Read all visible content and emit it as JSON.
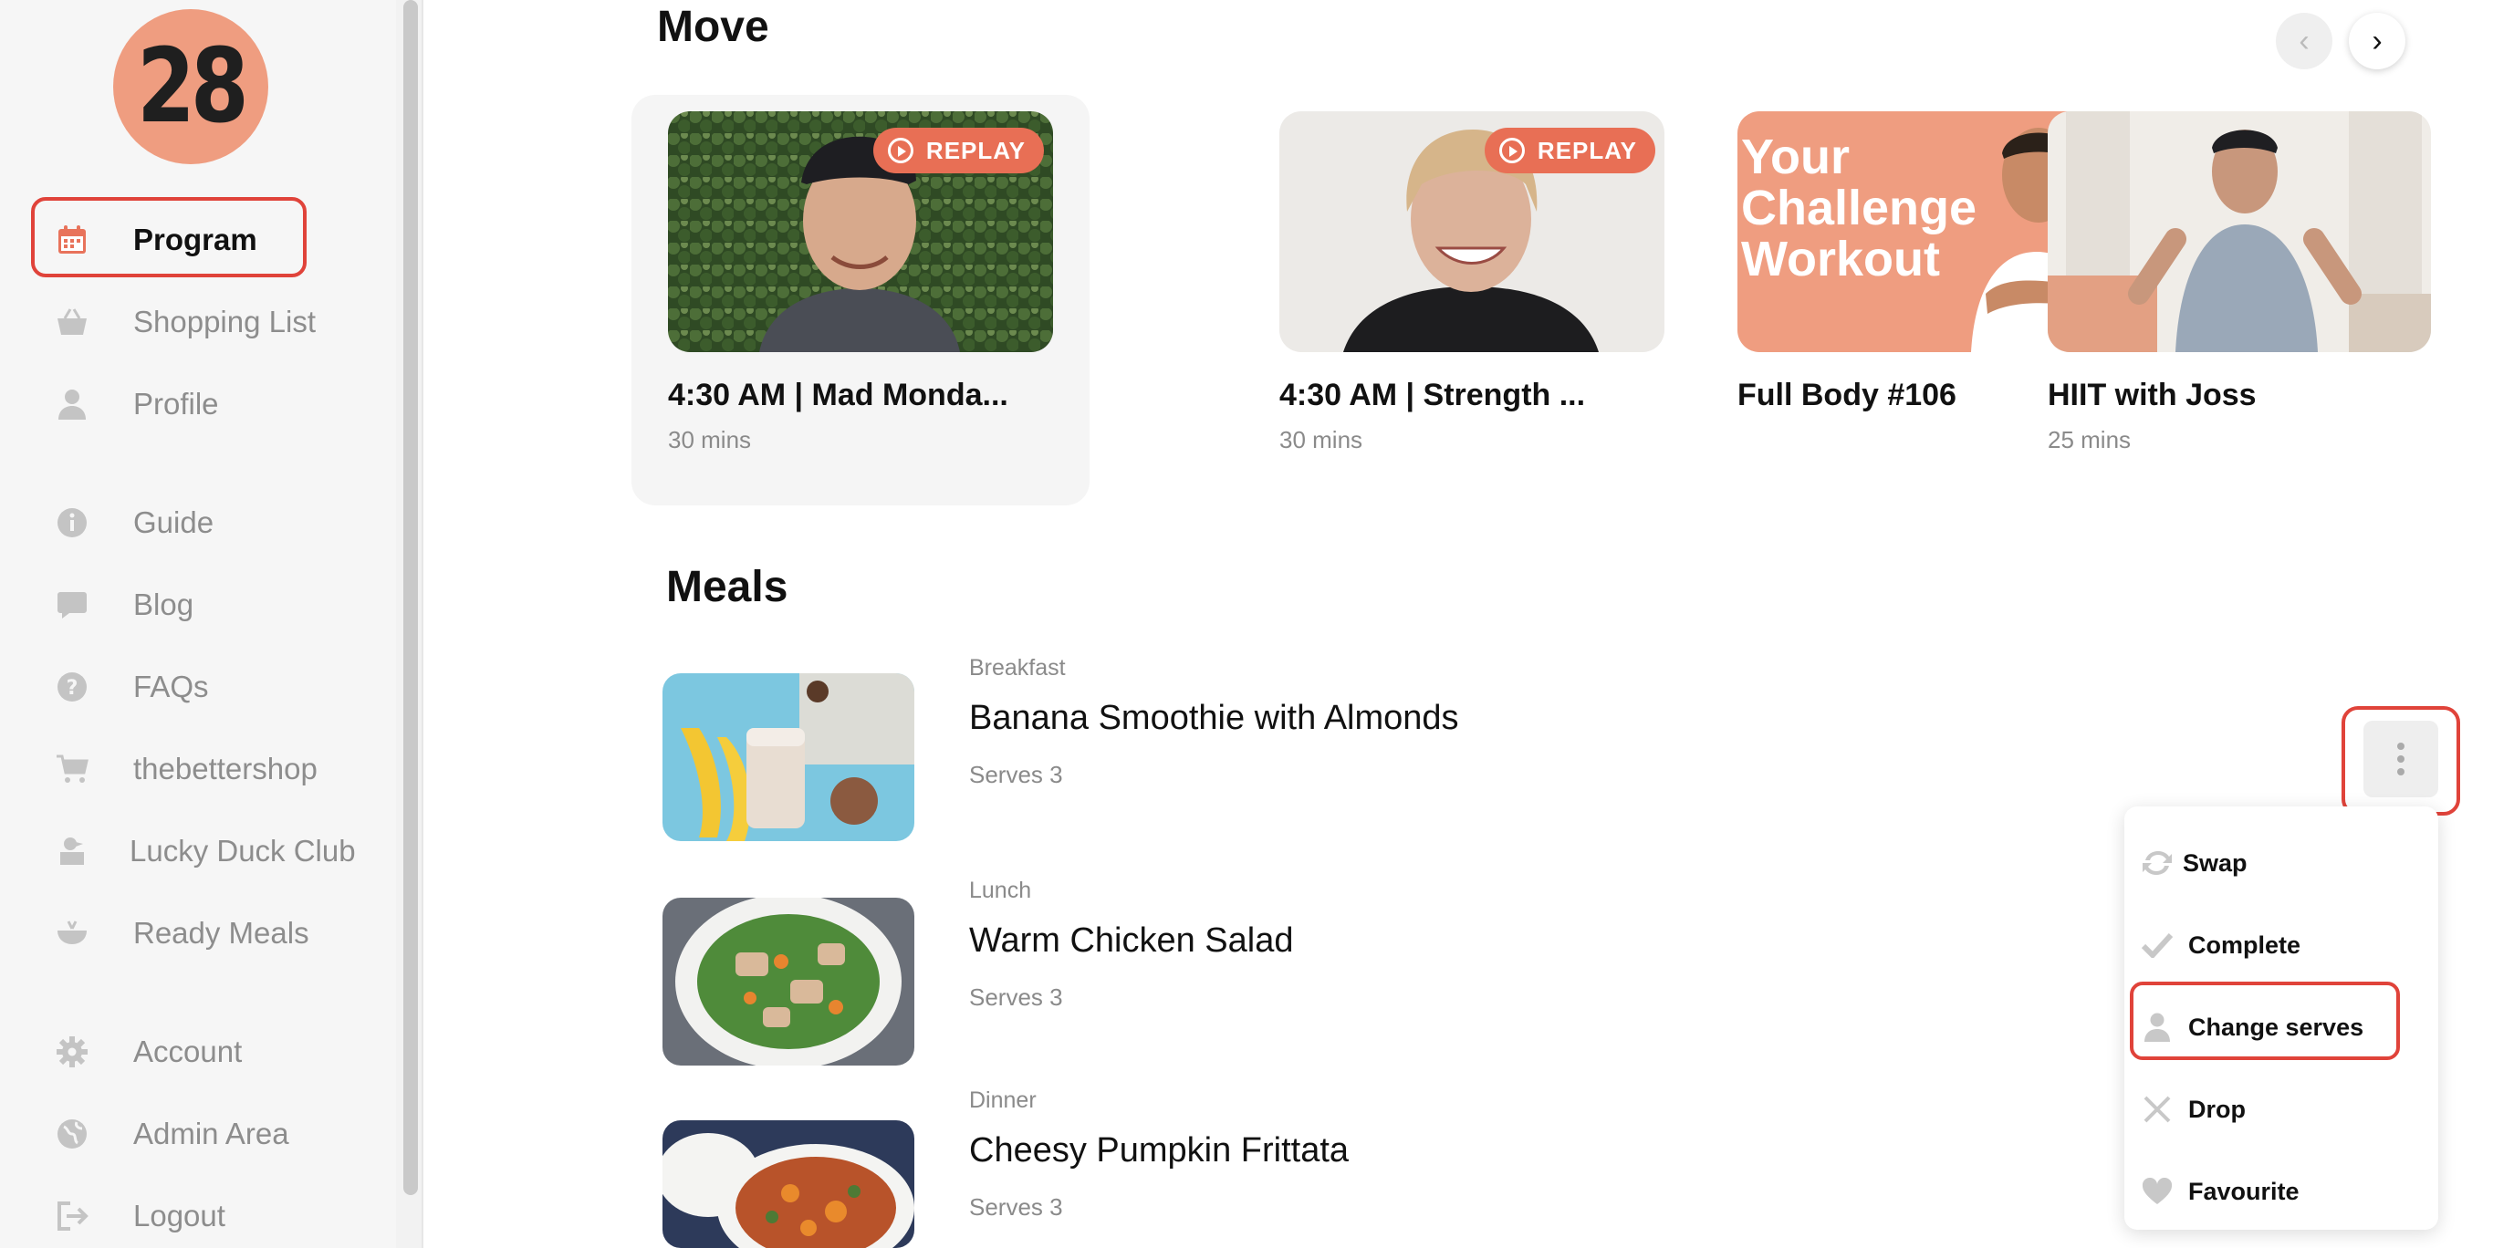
{
  "logo": {
    "text": "28"
  },
  "sidebar": {
    "items": [
      {
        "label": "Program",
        "icon": "calendar-icon",
        "active": true
      },
      {
        "label": "Shopping List",
        "icon": "basket-icon"
      },
      {
        "label": "Profile",
        "icon": "person-icon"
      },
      {
        "label": "Guide",
        "icon": "info-icon"
      },
      {
        "label": "Blog",
        "icon": "chat-bubble-icon"
      },
      {
        "label": "FAQs",
        "icon": "question-icon"
      },
      {
        "label": "thebettershop",
        "icon": "cart-icon"
      },
      {
        "label": "Lucky Duck Club",
        "icon": "duck-icon"
      },
      {
        "label": "Ready Meals",
        "icon": "bowl-icon"
      },
      {
        "label": "Account",
        "icon": "gear-icon"
      },
      {
        "label": "Admin Area",
        "icon": "globe-icon"
      },
      {
        "label": "Logout",
        "icon": "logout-icon"
      }
    ]
  },
  "move": {
    "title": "Move",
    "workouts": [
      {
        "title": "4:30 AM | Mad Monda...",
        "duration": "30 mins",
        "badge": "REPLAY"
      },
      {
        "title": "4:30 AM | Strength ...",
        "duration": "30 mins",
        "badge": "REPLAY"
      },
      {
        "title": "Full Body #106",
        "duration": "",
        "thumb_text": "Your Challenge Workout"
      },
      {
        "title": "HIIT with Joss",
        "duration": "25 mins"
      }
    ]
  },
  "meals": {
    "title": "Meals",
    "items": [
      {
        "type": "Breakfast",
        "name": "Banana Smoothie with Almonds",
        "serves": "Serves 3"
      },
      {
        "type": "Lunch",
        "name": "Warm Chicken Salad",
        "serves": "Serves 3"
      },
      {
        "type": "Dinner",
        "name": "Cheesy Pumpkin Frittata",
        "serves": "Serves 3"
      }
    ]
  },
  "meal_menu": {
    "items": [
      {
        "label": "Swap",
        "icon": "swap-icon"
      },
      {
        "label": "Complete",
        "icon": "check-icon"
      },
      {
        "label": "Change serves",
        "icon": "person-icon"
      },
      {
        "label": "Drop",
        "icon": "close-icon"
      },
      {
        "label": "Favourite",
        "icon": "heart-icon"
      }
    ]
  },
  "colors": {
    "accent": "#e86f55",
    "highlight": "#e0433a",
    "logo_bg": "#ef9d80"
  }
}
